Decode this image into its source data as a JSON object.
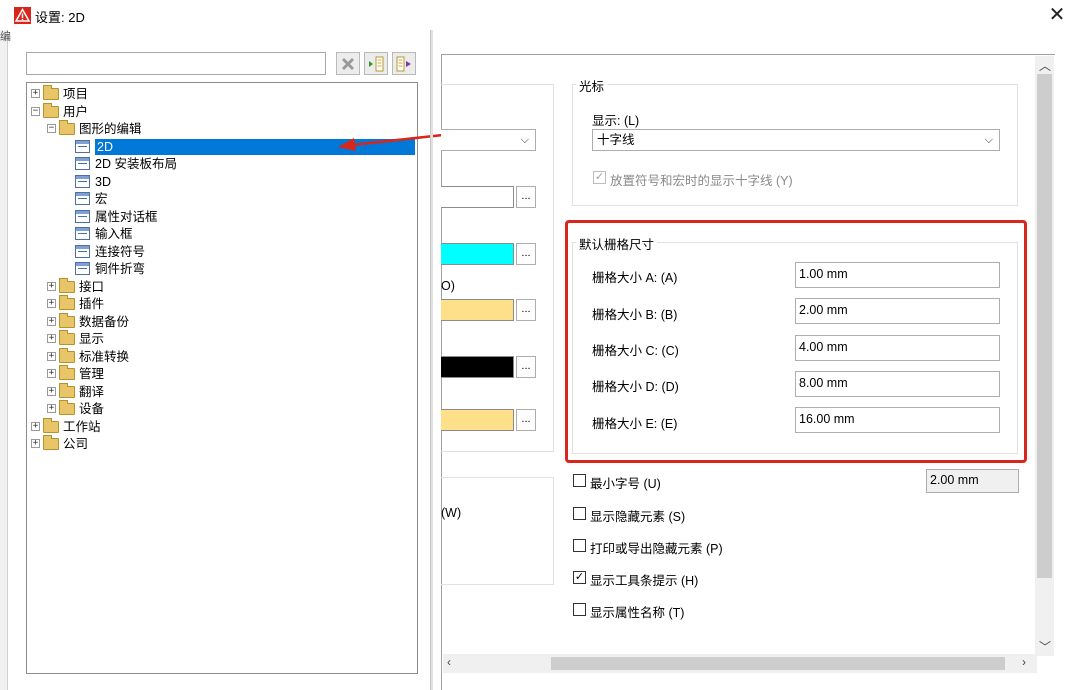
{
  "window": {
    "title": "设置: 2D",
    "close_glyph": "✕"
  },
  "bleed": {
    "chars": [
      "编",
      "编"
    ]
  },
  "tree": {
    "items": [
      {
        "label": "项目",
        "type": "folder",
        "expander": "+"
      },
      {
        "label": "用户",
        "type": "folder",
        "expander": "−"
      },
      {
        "label": "图形的编辑",
        "type": "folder",
        "expander": "−"
      },
      {
        "label": "2D",
        "type": "page",
        "selected": true
      },
      {
        "label": "2D 安装板布局",
        "type": "page"
      },
      {
        "label": "3D",
        "type": "page"
      },
      {
        "label": "宏",
        "type": "page"
      },
      {
        "label": "属性对话框",
        "type": "page"
      },
      {
        "label": "输入框",
        "type": "page"
      },
      {
        "label": "连接符号",
        "type": "page"
      },
      {
        "label": "铜件折弯",
        "type": "page"
      },
      {
        "label": "接口",
        "type": "folder",
        "expander": "+"
      },
      {
        "label": "插件",
        "type": "folder",
        "expander": "+"
      },
      {
        "label": "数据备份",
        "type": "folder",
        "expander": "+"
      },
      {
        "label": "显示",
        "type": "folder",
        "expander": "+"
      },
      {
        "label": "标准转换",
        "type": "folder",
        "expander": "+"
      },
      {
        "label": "管理",
        "type": "folder",
        "expander": "+"
      },
      {
        "label": "翻译",
        "type": "folder",
        "expander": "+"
      },
      {
        "label": "设备",
        "type": "folder",
        "expander": "+"
      },
      {
        "label": "工作站",
        "type": "folder",
        "expander": "+"
      },
      {
        "label": "公司",
        "type": "folder",
        "expander": "+"
      }
    ]
  },
  "left_partial": {
    "o_label": "O)",
    "w_label": "(W)",
    "dots": "...",
    "colors": [
      "#ffffff",
      "#00ffff",
      "#ffe08a",
      "#000000",
      "#ffe08a"
    ]
  },
  "cursor_group": {
    "title": "光标",
    "display_label": "显示: (L)",
    "display_value": "十字线",
    "checkbox_label": "放置符号和宏时的显示十字线 (Y)",
    "checkbox_mark": "✓"
  },
  "grid_group": {
    "title": "默认栅格尺寸",
    "rows": [
      {
        "label": "栅格大小 A: (A)",
        "value": "1.00 mm"
      },
      {
        "label": "栅格大小 B: (B)",
        "value": "2.00 mm"
      },
      {
        "label": "栅格大小 C: (C)",
        "value": "4.00 mm"
      },
      {
        "label": "栅格大小 D: (D)",
        "value": "8.00 mm"
      },
      {
        "label": "栅格大小 E: (E)",
        "value": "16.00 mm"
      }
    ]
  },
  "options": {
    "min_font_label": "最小字号 (U)",
    "min_font_value": "2.00 mm",
    "items": [
      {
        "label": "最小字号 (U)",
        "checked": false
      },
      {
        "label": "显示隐藏元素 (S)",
        "checked": false
      },
      {
        "label": "打印或导出隐藏元素 (P)",
        "checked": false
      },
      {
        "label": "显示工具条提示 (H)",
        "checked": true
      },
      {
        "label": "显示属性名称 (T)",
        "checked": false
      }
    ],
    "check_mark": "✓"
  },
  "colors": {
    "selection": "#0078d7",
    "highlight_box": "#d9261c",
    "arrow": "#d9261c"
  }
}
